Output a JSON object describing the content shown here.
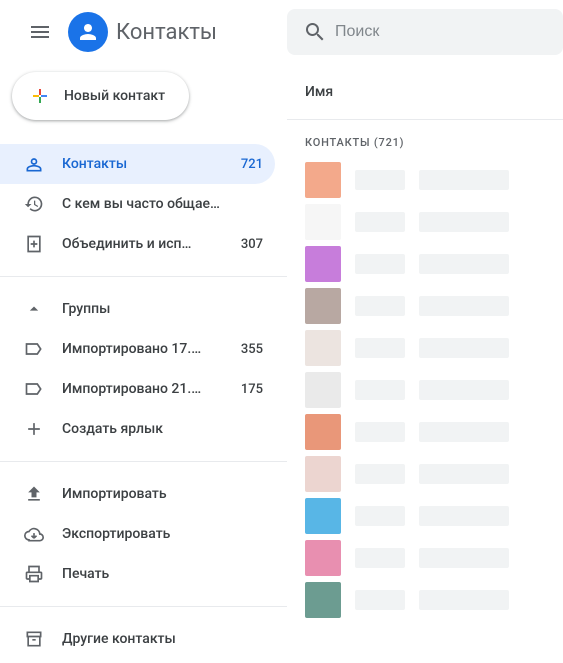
{
  "header": {
    "app_title": "Контакты"
  },
  "search": {
    "placeholder": "Поиск"
  },
  "new_contact": {
    "label": "Новый контакт"
  },
  "nav": {
    "contacts": {
      "label": "Контакты",
      "count": "721"
    },
    "frequent": {
      "label": "С кем вы часто общае…"
    },
    "merge": {
      "label": "Объединить и исп…",
      "count": "307"
    },
    "labels_header": "Группы",
    "labels": [
      {
        "label": "Импортировано 17.…",
        "count": "355"
      },
      {
        "label": "Импортировано 21.…",
        "count": "175"
      }
    ],
    "create_label": "Создать ярлык",
    "import": "Импортировать",
    "export": "Экспортировать",
    "print": "Печать",
    "other": "Другие контакты"
  },
  "list": {
    "column_name": "Имя",
    "section_label": "КОНТАКТЫ (721)",
    "rows": [
      {
        "color": "#f3a98b"
      },
      {
        "color": "#f6f6f6"
      },
      {
        "color": "#c77ddb"
      },
      {
        "color": "#b8a8a2"
      },
      {
        "color": "#ece4e0"
      },
      {
        "color": "#eaeaea"
      },
      {
        "color": "#e99779"
      },
      {
        "color": "#ecd5d0"
      },
      {
        "color": "#58b6e6"
      },
      {
        "color": "#e88fb0"
      },
      {
        "color": "#6c9c91"
      }
    ]
  }
}
